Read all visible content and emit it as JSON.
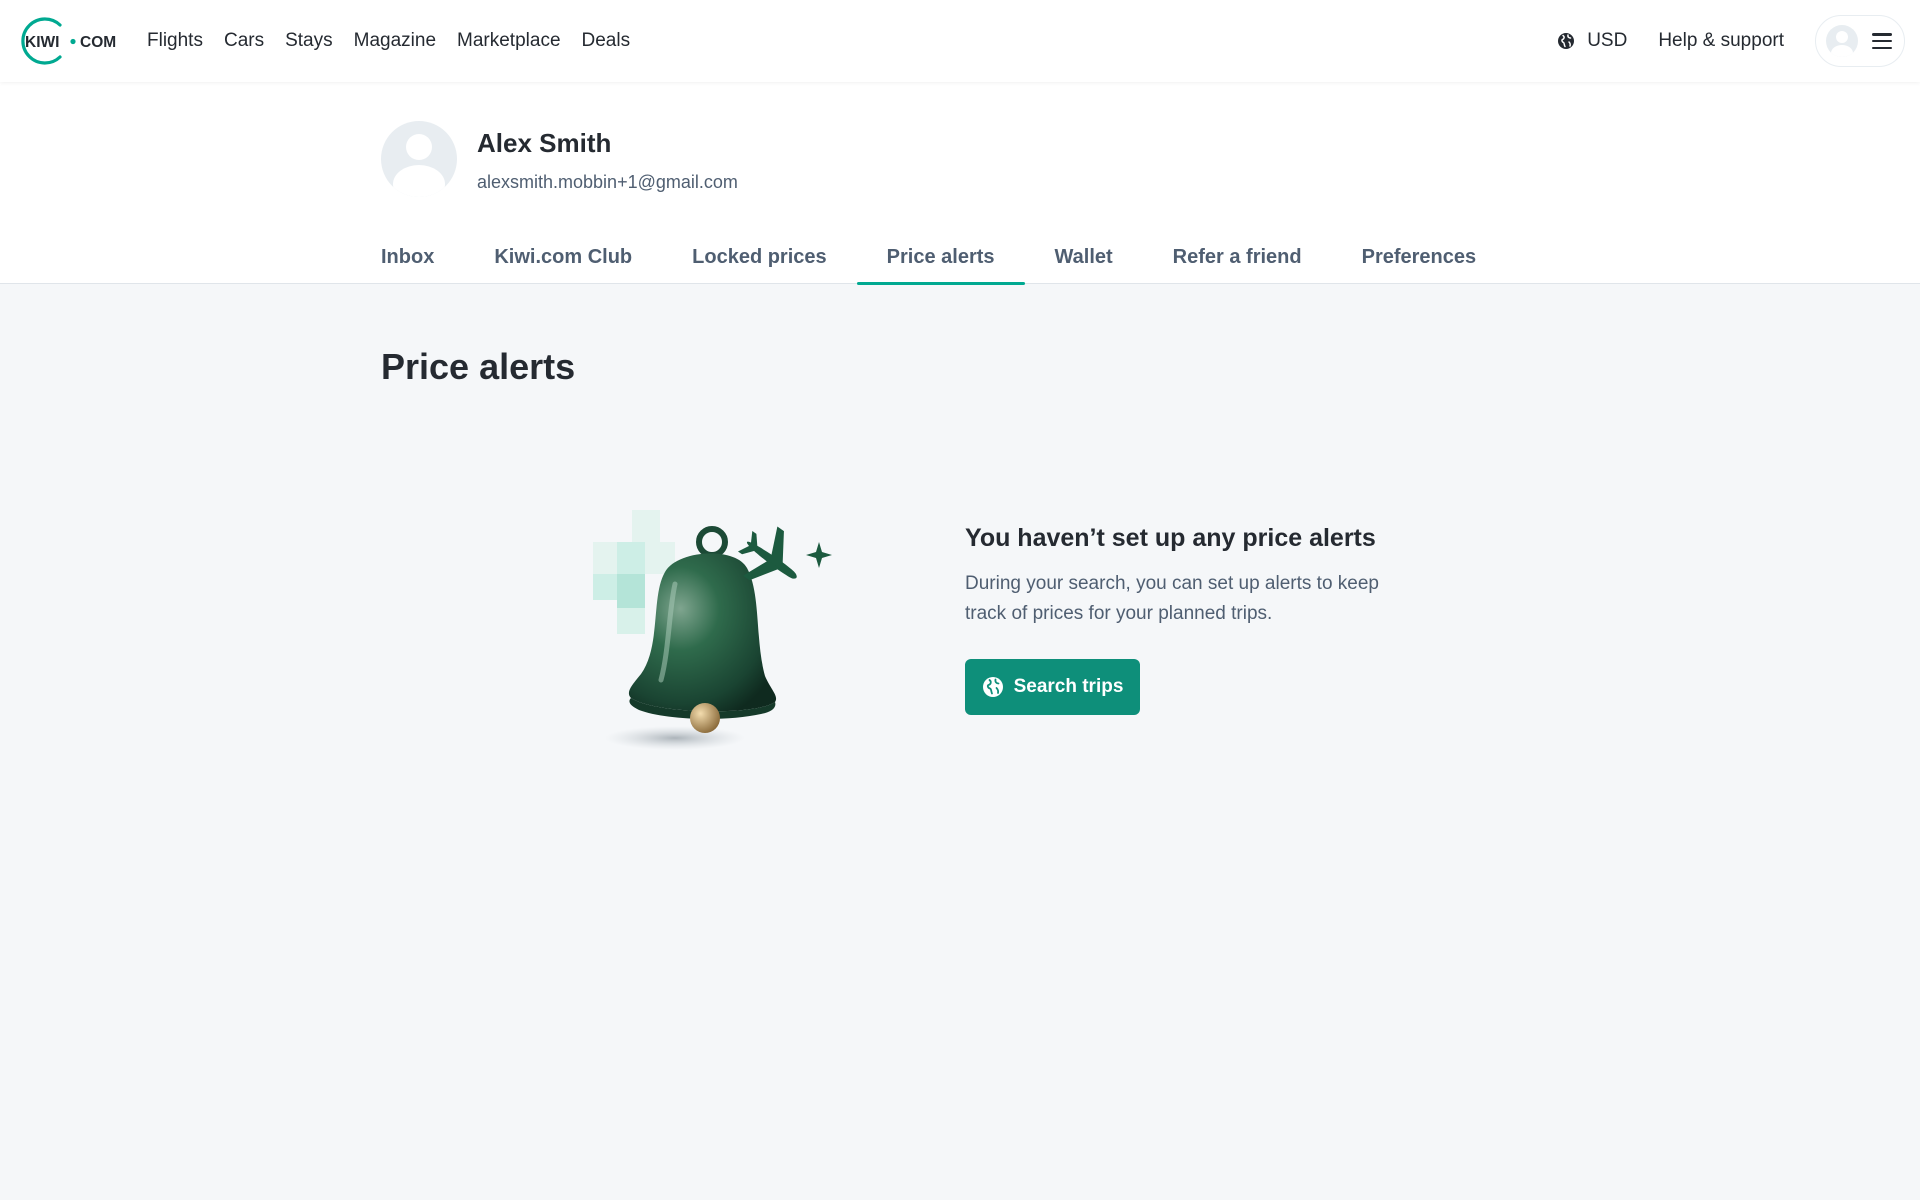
{
  "header": {
    "logo_alt": "kiwi.com",
    "nav": [
      {
        "label": "Flights"
      },
      {
        "label": "Cars"
      },
      {
        "label": "Stays"
      },
      {
        "label": "Magazine"
      },
      {
        "label": "Marketplace"
      },
      {
        "label": "Deals"
      }
    ],
    "currency": "USD",
    "help_label": "Help & support"
  },
  "profile": {
    "name": "Alex Smith",
    "email": "alexsmith.mobbin+1@gmail.com"
  },
  "tabs": [
    {
      "label": "Inbox",
      "active": false
    },
    {
      "label": "Kiwi.com Club",
      "active": false
    },
    {
      "label": "Locked prices",
      "active": false
    },
    {
      "label": "Price alerts",
      "active": true
    },
    {
      "label": "Wallet",
      "active": false
    },
    {
      "label": "Refer a friend",
      "active": false
    },
    {
      "label": "Preferences",
      "active": false
    }
  ],
  "main": {
    "title": "Price alerts",
    "empty_title": "You haven’t set up any price alerts",
    "empty_text": "During your search, you can set up alerts to keep track of prices for your planned trips.",
    "cta_label": "Search trips"
  },
  "colors": {
    "brand": "#00a991",
    "cta": "#0e8f7a",
    "page_bg": "#f5f7f9",
    "text": "#252a31",
    "muted": "#4f5e71"
  },
  "icons": [
    "globe-icon",
    "hamburger-icon",
    "avatar-icon",
    "bell-illustration",
    "plane-icon",
    "sparkle-icon"
  ]
}
